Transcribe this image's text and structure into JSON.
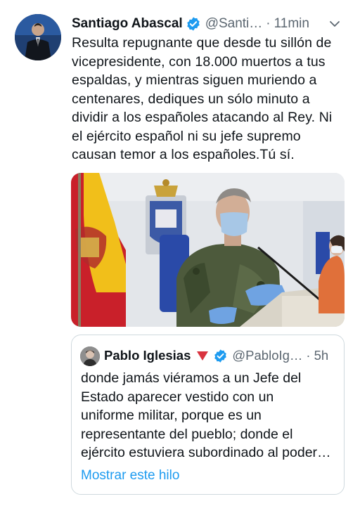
{
  "tweet": {
    "author_name": "Santiago Abascal",
    "handle": "@Santi…",
    "separator": "·",
    "time": "11min",
    "text_lines": [
      "Resulta repugnante que desde tu sillón de",
      "vicepresidente, con 18.000 muertos  a tus",
      "espaldas, y mientras siguen muriendo a",
      "centenares, dediques un sólo minuto a",
      "dividir a los españoles atacando al Rey. Ni",
      "el ejército español ni su jefe supremo",
      "causan temor a los españoles.Tú sí."
    ]
  },
  "icons": {
    "verified": "verified-badge-icon",
    "more": "chevron-down-icon",
    "party": "red-triangle-icon"
  },
  "quoted": {
    "author_name": "Pablo Iglesias",
    "handle": "@PabloIg…",
    "separator": "·",
    "time": "5h",
    "text_lines": [
      "donde jamás viéramos a un Jefe del",
      "Estado aparecer vestido con un",
      "uniforme militar, porque es un",
      "representante del pueblo; donde el",
      "ejército estuviera subordinado al poder…"
    ],
    "show_thread": "Mostrar este hilo"
  },
  "colors": {
    "link": "#1d9bf0",
    "verified": "#1d9bf0",
    "muted_text": "#5b6670",
    "border": "#cfd9de",
    "party_red": "#d9333f"
  }
}
